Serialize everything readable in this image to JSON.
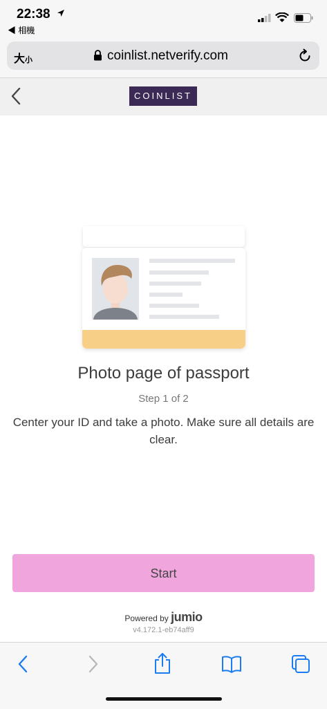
{
  "status": {
    "time": "22:38",
    "back_app": "◀ 相機"
  },
  "address": {
    "text_size": "大",
    "text_size_small": "小",
    "url": "coinlist.netverify.com"
  },
  "header": {
    "logo": "COINLIST"
  },
  "main": {
    "title": "Photo page of passport",
    "step": "Step 1 of 2",
    "description": "Center your ID and take a photo. Make sure all details are clear.",
    "start_label": "Start"
  },
  "footer": {
    "powered_by": "Powered by",
    "brand": "jumio",
    "version": "v4.172.1-eb74aff9"
  },
  "colors": {
    "accent_button": "#f0a6dd",
    "logo_bg": "#3b2a56",
    "passport_stripe": "#f7cf86",
    "ios_blue": "#1a7cf0"
  }
}
